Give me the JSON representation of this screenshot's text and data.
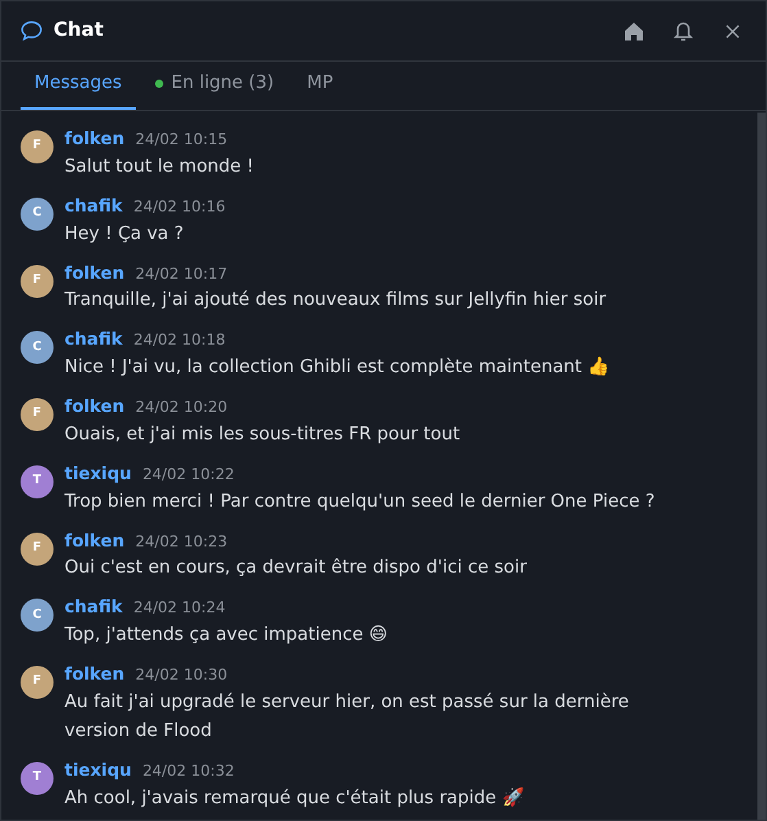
{
  "window": {
    "title": "Chat"
  },
  "tabs": [
    {
      "label": "Messages",
      "selected": true,
      "status_dot": false
    },
    {
      "label": "En ligne (3)",
      "selected": false,
      "status_dot": true
    },
    {
      "label": "MP",
      "selected": false,
      "status_dot": false
    }
  ],
  "messages": [
    {
      "initial": "F",
      "color": "#c4a57a",
      "author": "folken",
      "time": "24/02 10:15",
      "text": "Salut tout le monde !"
    },
    {
      "initial": "C",
      "color": "#7ea2cc",
      "author": "chafik",
      "time": "24/02 10:16",
      "text": "Hey ! Ça va ?"
    },
    {
      "initial": "F",
      "color": "#c4a57a",
      "author": "folken",
      "time": "24/02 10:17",
      "text": "Tranquille, j'ai ajouté des nouveaux films sur Jellyfin hier soir"
    },
    {
      "initial": "C",
      "color": "#7ea2cc",
      "author": "chafik",
      "time": "24/02 10:18",
      "text": "Nice ! J'ai vu, la collection Ghibli est complète maintenant 👍"
    },
    {
      "initial": "F",
      "color": "#c4a57a",
      "author": "folken",
      "time": "24/02 10:20",
      "text": "Ouais, et j'ai mis les sous-titres FR pour tout"
    },
    {
      "initial": "T",
      "color": "#a07fd3",
      "author": "tiexiqu",
      "time": "24/02 10:22",
      "text": "Trop bien merci ! Par contre quelqu'un seed le dernier One Piece ?"
    },
    {
      "initial": "F",
      "color": "#c4a57a",
      "author": "folken",
      "time": "24/02 10:23",
      "text": "Oui c'est en cours, ça devrait être dispo d'ici ce soir"
    },
    {
      "initial": "C",
      "color": "#7ea2cc",
      "author": "chafik",
      "time": "24/02 10:24",
      "text": "Top, j'attends ça avec impatience 😄"
    },
    {
      "initial": "F",
      "color": "#c4a57a",
      "author": "folken",
      "time": "24/02 10:30",
      "text": "Au fait j'ai upgradé le serveur hier, on est passé sur la dernière version de Flood"
    },
    {
      "initial": "T",
      "color": "#a07fd3",
      "author": "tiexiqu",
      "time": "24/02 10:32",
      "text": "Ah cool, j'avais remarqué que c'était plus rapide 🚀"
    }
  ]
}
